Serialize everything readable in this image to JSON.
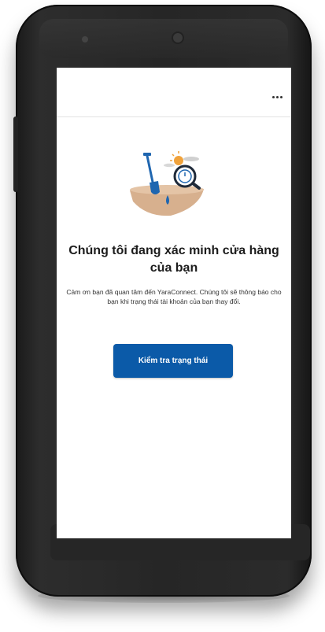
{
  "header": {
    "menu_icon": "more-horizontal-icon"
  },
  "illustration": {
    "icon": "verification-store-illustration"
  },
  "main": {
    "title": "Chúng tôi đang xác minh cửa hàng của bạn",
    "description": "Cảm ơn bạn đã quan tâm đến YaraConnect. Chúng tôi sẽ thông báo cho bạn khi trạng thái tài khoản của bạn thay đổi.",
    "check_status_button": "Kiểm tra trạng thái"
  },
  "colors": {
    "primary": "#0b5aa8",
    "illustration_sand": "#d7b08e",
    "illustration_blue": "#1f66b0",
    "sun": "#f0a23b"
  }
}
